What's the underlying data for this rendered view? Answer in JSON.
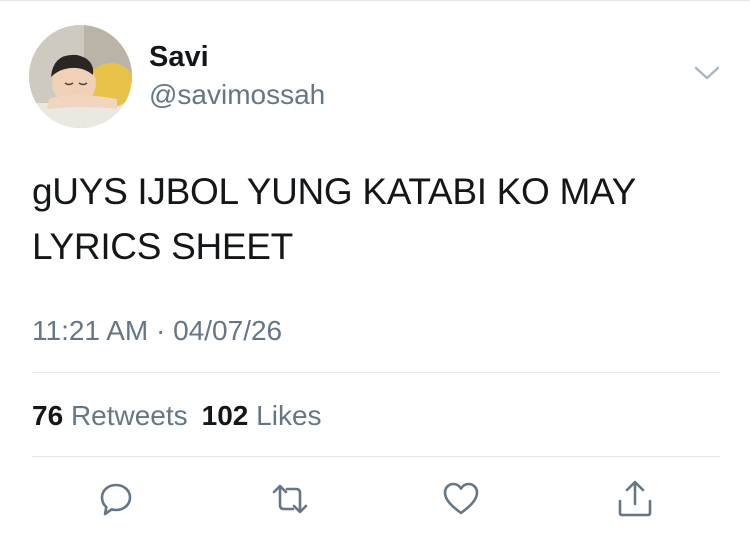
{
  "author": {
    "display_name": "Savi",
    "handle": "@savimossah"
  },
  "tweet": {
    "text_line_1": "gUYS IJBOL YUNG KATABI KO MAY",
    "text_line_2": "LYRICS SHEET",
    "time": "11:21 AM",
    "separator": "·",
    "date": "04/07/26"
  },
  "stats": {
    "retweets_count": "76",
    "retweets_label": "Retweets",
    "likes_count": "102",
    "likes_label": "Likes"
  },
  "icons": {
    "menu": "chevron-down-icon",
    "reply": "reply-icon",
    "retweet": "retweet-icon",
    "like": "heart-icon",
    "share": "share-icon"
  },
  "colors": {
    "text": "#14171a",
    "secondary": "#657786",
    "divider": "#e1e8ed"
  }
}
